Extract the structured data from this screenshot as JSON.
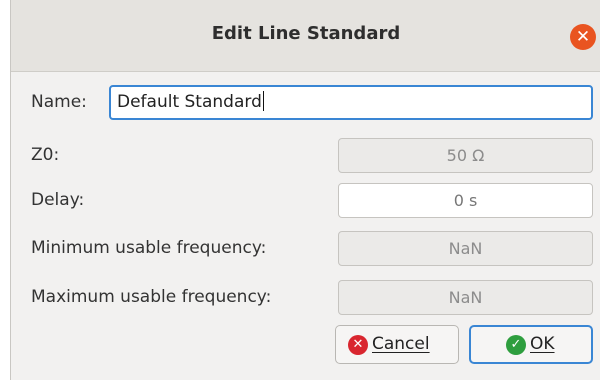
{
  "dialog": {
    "title": "Edit Line Standard",
    "close_symbol": "✕"
  },
  "form": {
    "name_label": "Name:",
    "name_value": "Default Standard",
    "z0_label": "Z0:",
    "z0_value": "50 Ω",
    "delay_label": "Delay:",
    "delay_value": "0 s",
    "min_freq_label": "Minimum usable frequency:",
    "min_freq_value": "NaN",
    "max_freq_label": "Maximum usable frequency:",
    "max_freq_value": "NaN"
  },
  "buttons": {
    "cancel_label": "Cancel",
    "cancel_icon": "✕",
    "ok_label": "OK",
    "ok_icon": "✓"
  },
  "colors": {
    "accent": "#3a86d4",
    "close": "#e95420",
    "cancel_icon": "#d9262f",
    "ok_icon": "#2e9e3e"
  }
}
